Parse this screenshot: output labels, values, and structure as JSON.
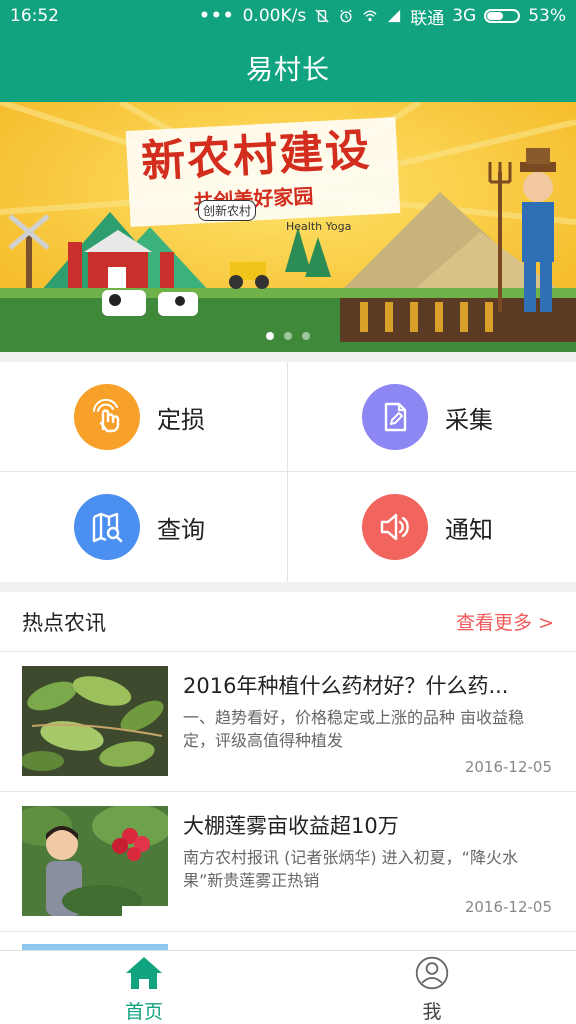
{
  "status_bar": {
    "time": "16:52",
    "dots": "•••",
    "speed": "0.00K/s",
    "carrier": "联通",
    "network": "3G",
    "battery": "53%",
    "battery_level": 0.53
  },
  "app_bar": {
    "title": "易村长"
  },
  "banner": {
    "title": "新农村建设",
    "subtitle": "共创美好家园",
    "badge": "创新农村",
    "brand": "Health Yoga",
    "slide_count": 3,
    "active_slide": 0
  },
  "actions": [
    {
      "label": "定损",
      "icon": "touch-hand-icon",
      "color": "#f7a02a"
    },
    {
      "label": "采集",
      "icon": "edit-document-icon",
      "color": "#8c87f2"
    },
    {
      "label": "查询",
      "icon": "map-search-icon",
      "color": "#4b90f0"
    },
    {
      "label": "通知",
      "icon": "speaker-icon",
      "color": "#f2655f"
    }
  ],
  "news": {
    "section_title": "热点农讯",
    "more_label": "查看更多 >",
    "items": [
      {
        "headline": "2016年种植什么药材好？什么药...",
        "summary": "一、趋势看好，价格稳定或上涨的品种  亩收益稳定，评级高值得种植发",
        "date": "2016-12-05",
        "thumb": "plant-leaves-photo"
      },
      {
        "headline": "大棚莲雾亩收益超10万",
        "summary": "南方农村报讯 (记者张炳华)    进入初夏，“降火水果”新贵莲雾正热销",
        "date": "2016-12-05",
        "thumb": "woman-fruit-photo"
      }
    ]
  },
  "bottom_nav": {
    "items": [
      {
        "label": "首页",
        "icon": "home-icon",
        "active": true
      },
      {
        "label": "我",
        "icon": "user-icon",
        "active": false
      }
    ]
  },
  "colors": {
    "primary": "#11a37f",
    "more_link": "#f05a5a"
  }
}
